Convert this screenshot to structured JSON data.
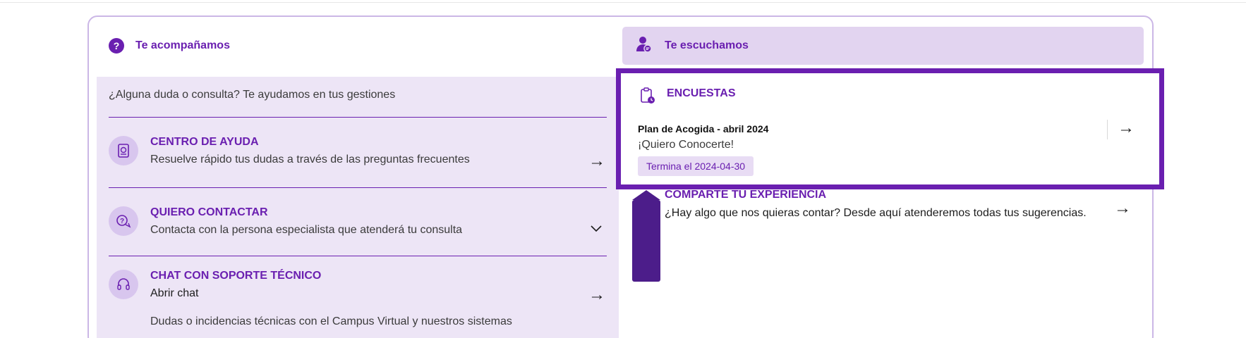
{
  "left": {
    "header": {
      "title": "Te acompañamos",
      "icon": "question-circle-icon"
    },
    "intro": "¿Alguna duda o consulta? Te ayudamos en tus gestiones",
    "items": [
      {
        "title": "CENTRO DE AYUDA",
        "subtitle": "Resuelve rápido tus dudas a través de las preguntas frecuentes",
        "icon": "help-book-icon",
        "action": "arrow-right-icon"
      },
      {
        "title": "QUIERO CONTACTAR",
        "subtitle": "Contacta con la persona especialista que atenderá tu consulta",
        "icon": "chat-question-icon",
        "action": "chevron-down-icon"
      },
      {
        "title": "CHAT CON SOPORTE TÉCNICO",
        "subtitle": "Abrir chat",
        "extra": "Dudas o incidencias técnicas con el Campus Virtual y nuestros sistemas",
        "icon": "headset-icon",
        "action": "arrow-right-icon"
      }
    ]
  },
  "right": {
    "header": {
      "title": "Te escuchamos",
      "icon": "user-chat-icon"
    },
    "surveys": {
      "title": "ENCUESTAS",
      "icon": "clipboard-clock-icon",
      "item": {
        "title": "Plan de Acogida - abril 2024",
        "subtitle": "¡Quiero Conocerte!",
        "badge": "Termina el 2024-04-30"
      }
    },
    "share": {
      "title": "COMPARTE TU EXPERIENCIA",
      "subtitle": "¿Hay algo que nos quieras contar? Desde aquí atenderemos todas tus sugerencias."
    }
  },
  "colors": {
    "accent": "#6a1fb0",
    "panel_bg": "#ede5f6",
    "header_bg": "#e2d4f0",
    "highlight_border": "#6a1fb0"
  }
}
